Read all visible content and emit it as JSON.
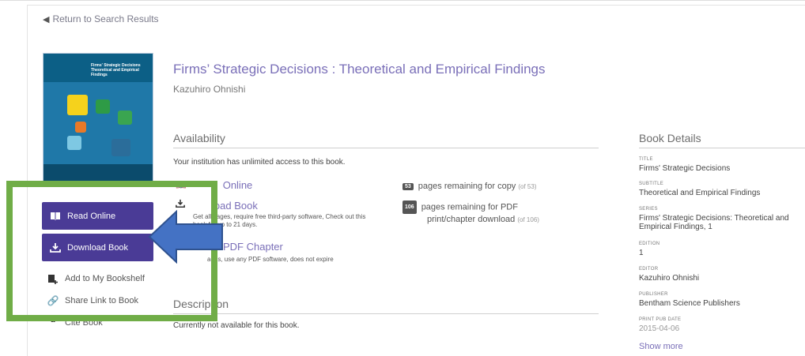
{
  "nav": {
    "back_label": "Return to Search Results"
  },
  "cover": {
    "title_line1": "Firms' Strategic Decisions",
    "title_line2": "Theoretical and Empirical Findings"
  },
  "book": {
    "title": "Firms’ Strategic Decisions : Theoretical and Empirical Findings",
    "author": "Kazuhiro Ohnishi"
  },
  "actions": {
    "read_online": "Read Online",
    "download_book": "Download Book",
    "add_bookshelf": "Add to My Bookshelf",
    "share_link": "Share Link to Book",
    "cite_book": "Cite Book"
  },
  "availability": {
    "heading": "Availability",
    "access_note": "Your institution has unlimited access to this book.",
    "read_online": "Online",
    "download_label": "load Book",
    "download_note": "Get all pages, require free third-party software, Check out this book for up to 21 days.",
    "pdf_chapter_label": "PDF Chapter",
    "pdf_chapter_note": "ages, use any PDF software, does not expire",
    "copy_count": "53",
    "copy_text": "pages remaining for copy",
    "copy_of": "(of 53)",
    "print_count": "106",
    "print_text_1": "pages remaining for PDF",
    "print_text_2": "print/chapter download",
    "print_of": "(of 106)"
  },
  "description": {
    "heading": "Description",
    "text": "Currently not available for this book."
  },
  "details": {
    "heading": "Book Details",
    "items": [
      {
        "label": "TITLE",
        "value": "Firms' Strategic Decisions"
      },
      {
        "label": "SUBTITLE",
        "value": "Theoretical and Empirical Findings"
      },
      {
        "label": "SERIES",
        "value": "Firms' Strategic Decisions: Theoretical and Empirical Findings, 1"
      },
      {
        "label": "EDITION",
        "value": "1"
      },
      {
        "label": "EDITOR",
        "value": "Kazuhiro Ohnishi"
      },
      {
        "label": "PUBLISHER",
        "value": "Bentham Science Publishers"
      },
      {
        "label": "PRINT PUB DATE",
        "value": "2015-04-06"
      }
    ],
    "show_more": "Show more"
  },
  "colors": {
    "button_bg": "#4a3b96",
    "link": "#7a6fb8",
    "annotation_box": "#70ad47",
    "annotation_arrow": "#4472c4"
  }
}
